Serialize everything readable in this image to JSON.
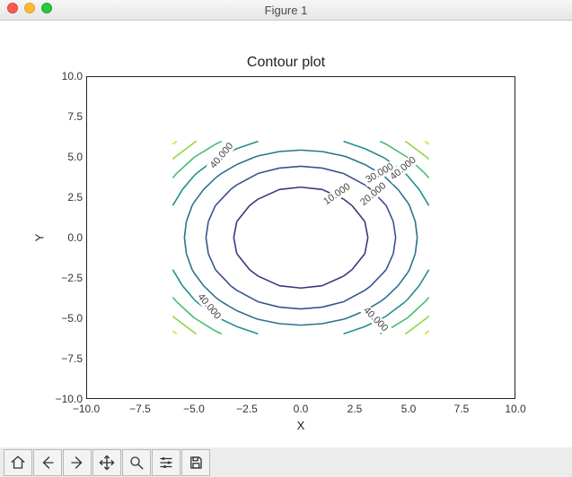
{
  "window": {
    "title": "Figure 1"
  },
  "chart_data": {
    "type": "contour",
    "title": "Contour plot",
    "xlabel": "X",
    "ylabel": "Y",
    "xlim": [
      -10.0,
      10.0
    ],
    "ylim": [
      -10.0,
      10.0
    ],
    "xticks": [
      "−10.0",
      "−7.5",
      "−5.0",
      "−2.5",
      "0.0",
      "2.5",
      "5.0",
      "7.5",
      "10.0"
    ],
    "yticks": [
      "−10.0",
      "−7.5",
      "−5.0",
      "−2.5",
      "0.0",
      "2.5",
      "5.0",
      "7.5",
      "10.0"
    ],
    "z_expression": "x**2 + y**2",
    "xgrid": [
      -6,
      -5,
      -4,
      -3,
      -2,
      -1,
      0,
      1,
      2,
      3,
      4,
      5,
      6
    ],
    "ygrid": [
      -6,
      -5,
      -4,
      -3,
      -2,
      -1,
      0,
      1,
      2,
      3,
      4,
      5,
      6
    ],
    "contour_levels": [
      10,
      20,
      30,
      40,
      50,
      60,
      70
    ],
    "contour_colors": [
      "#472f7d",
      "#3a528b",
      "#2c718e",
      "#21908c",
      "#42be71",
      "#8fd645",
      "#d2e11b"
    ],
    "contour_label_text": [
      "10.000",
      "20.000",
      "30.000",
      "40.000",
      "40.000",
      "40.000",
      "40.000"
    ],
    "labeled_levels": [
      {
        "level": 10,
        "text": "10.000"
      },
      {
        "level": 20,
        "text": "20.000"
      },
      {
        "level": 30,
        "text": "30.000"
      },
      {
        "level": 40,
        "text": "40.000"
      }
    ]
  },
  "toolbar": {
    "buttons": [
      "home",
      "back",
      "forward",
      "pan",
      "zoom",
      "configure",
      "save"
    ]
  }
}
